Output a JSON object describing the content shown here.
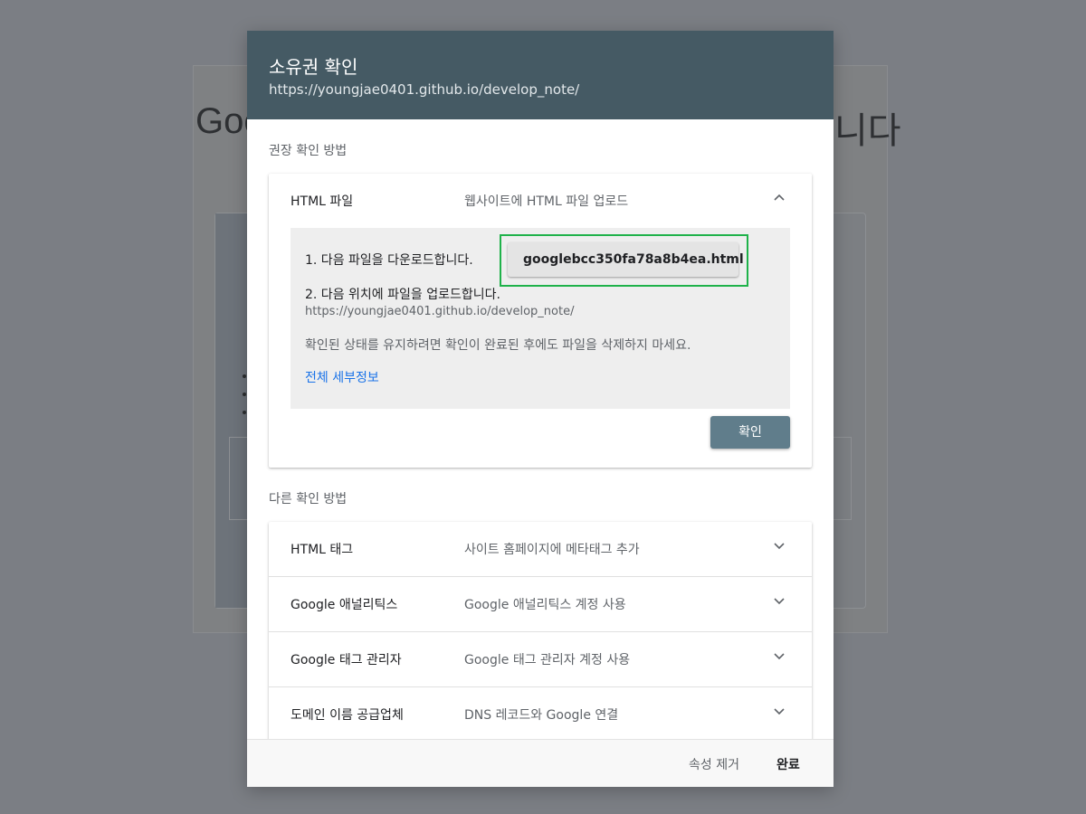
{
  "background": {
    "title_left": "Goo",
    "title_right": "니다"
  },
  "dialog": {
    "title": "소유권 확인",
    "subtitle": "https://youngjae0401.github.io/develop_note/",
    "recommended_label": "권장 확인 방법",
    "recommended": {
      "name": "HTML 파일",
      "description": "웹사이트에 HTML 파일 업로드",
      "chevron_icon": "chevron-up-icon",
      "step1": "1. 다음 파일을 다운로드합니다.",
      "download_file": "googlebcc350fa78a8b4ea.html",
      "download_icon": "download-icon",
      "step2": "2. 다음 위치에 파일을 업로드합니다.",
      "step2_url": "https://youngjae0401.github.io/develop_note/",
      "note": "확인된 상태를 유지하려면 확인이 완료된 후에도 파일을 삭제하지 마세요.",
      "details_link": "전체 세부정보",
      "confirm_label": "확인"
    },
    "other_label": "다른 확인 방법",
    "other_methods": [
      {
        "name": "HTML 태그",
        "description": "사이트 홈페이지에 메타태그 추가",
        "icon": "chevron-down-icon"
      },
      {
        "name": "Google 애널리틱스",
        "description": "Google 애널리틱스 계정 사용",
        "icon": "chevron-down-icon"
      },
      {
        "name": "Google 태그 관리자",
        "description": "Google 태그 관리자 계정 사용",
        "icon": "chevron-down-icon"
      },
      {
        "name": "도메인 이름 공급업체",
        "description": "DNS 레코드와 Google 연결",
        "icon": "chevron-down-icon"
      }
    ],
    "footer": {
      "remove_label": "속성 제거",
      "done_label": "완료"
    }
  },
  "colors": {
    "header": "#455a64",
    "confirm_button": "#607d8b",
    "highlight_frame": "#1fb24a",
    "link": "#1a73e8"
  }
}
